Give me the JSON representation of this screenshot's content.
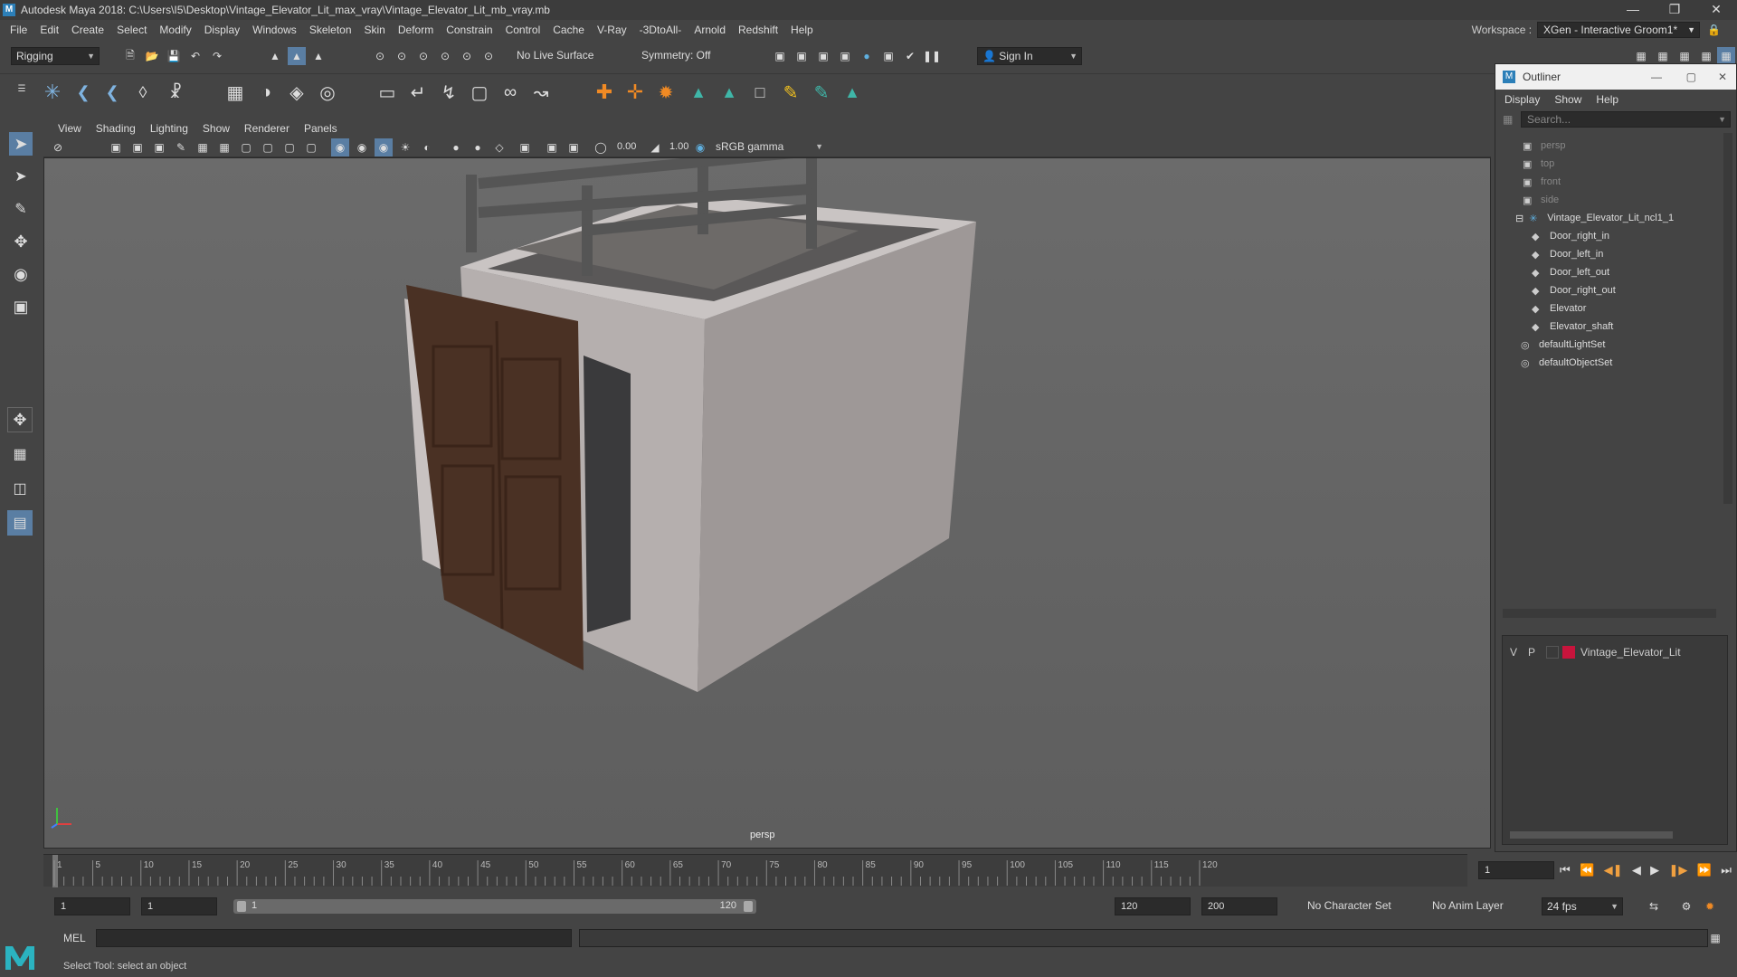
{
  "window": {
    "title": "Autodesk Maya 2018: C:\\Users\\I5\\Desktop\\Vintage_Elevator_Lit_max_vray\\Vintage_Elevator_Lit_mb_vray.mb"
  },
  "menubar": [
    "File",
    "Edit",
    "Create",
    "Select",
    "Modify",
    "Display",
    "Windows",
    "Skeleton",
    "Skin",
    "Deform",
    "Constrain",
    "Control",
    "Cache",
    "V-Ray",
    "-3DtoAll-",
    "Arnold",
    "Redshift",
    "Help"
  ],
  "workspace": {
    "label": "Workspace :",
    "value": "XGen - Interactive Groom1*"
  },
  "status": {
    "mode": "Rigging",
    "live_surface": "No Live Surface",
    "symmetry": "Symmetry: Off",
    "sign_in": "Sign In"
  },
  "viewport": {
    "menus": [
      "View",
      "Shading",
      "Lighting",
      "Show",
      "Renderer",
      "Panels"
    ],
    "exposure": "0.00",
    "gamma": "1.00",
    "colorspace": "sRGB gamma",
    "camera": "persp"
  },
  "outliner": {
    "title": "Outliner",
    "menus": [
      "Display",
      "Show",
      "Help"
    ],
    "search_placeholder": "Search...",
    "items": [
      {
        "label": "persp",
        "dim": true,
        "icon": "camera-icon"
      },
      {
        "label": "top",
        "dim": true,
        "icon": "camera-icon"
      },
      {
        "label": "front",
        "dim": true,
        "icon": "camera-icon"
      },
      {
        "label": "side",
        "dim": true,
        "icon": "camera-icon"
      },
      {
        "label": "Vintage_Elevator_Lit_ncl1_1",
        "dim": false,
        "icon": "group-icon"
      },
      {
        "label": "Door_right_in",
        "dim": false,
        "icon": "transform-icon"
      },
      {
        "label": "Door_left_in",
        "dim": false,
        "icon": "transform-icon"
      },
      {
        "label": "Door_left_out",
        "dim": false,
        "icon": "transform-icon"
      },
      {
        "label": "Door_right_out",
        "dim": false,
        "icon": "transform-icon"
      },
      {
        "label": "Elevator",
        "dim": false,
        "icon": "transform-icon"
      },
      {
        "label": "Elevator_shaft",
        "dim": false,
        "icon": "transform-icon"
      },
      {
        "label": "defaultLightSet",
        "dim": false,
        "icon": "set-icon"
      },
      {
        "label": "defaultObjectSet",
        "dim": false,
        "icon": "set-icon"
      }
    ]
  },
  "layers": {
    "v": "V",
    "p": "P",
    "name": "Vintage_Elevator_Lit",
    "color": "#c8143c"
  },
  "timeline": {
    "ticks": [
      "1",
      "5",
      "10",
      "15",
      "20",
      "25",
      "30",
      "35",
      "40",
      "45",
      "50",
      "55",
      "60",
      "65",
      "70",
      "75",
      "80",
      "85",
      "90",
      "95",
      "100",
      "105",
      "110",
      "115",
      "120"
    ],
    "current_frame": "1"
  },
  "range": {
    "start": "1",
    "start2": "1",
    "slider_start": "1",
    "slider_end": "120",
    "end": "120",
    "end2": "200",
    "character_set": "No Character Set",
    "anim_layer": "No Anim Layer",
    "fps": "24 fps"
  },
  "cmd": {
    "label": "MEL"
  },
  "help": {
    "text": "Select Tool: select an object"
  }
}
